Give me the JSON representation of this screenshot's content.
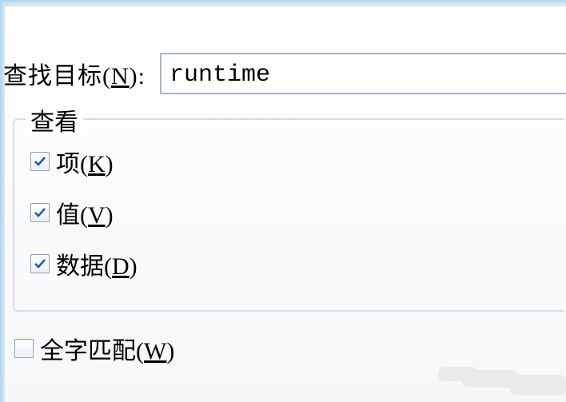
{
  "search": {
    "label_text": "查找目标",
    "label_mnemonic": "N",
    "label_suffix": ":",
    "value": "runtime"
  },
  "view": {
    "legend": "查看",
    "items": [
      {
        "text": "项",
        "mnemonic": "K",
        "checked": true
      },
      {
        "text": "值",
        "mnemonic": "V",
        "checked": true
      },
      {
        "text": "数据",
        "mnemonic": "D",
        "checked": true
      }
    ]
  },
  "whole_word": {
    "text": "全字匹配",
    "mnemonic": "W",
    "checked": false
  }
}
